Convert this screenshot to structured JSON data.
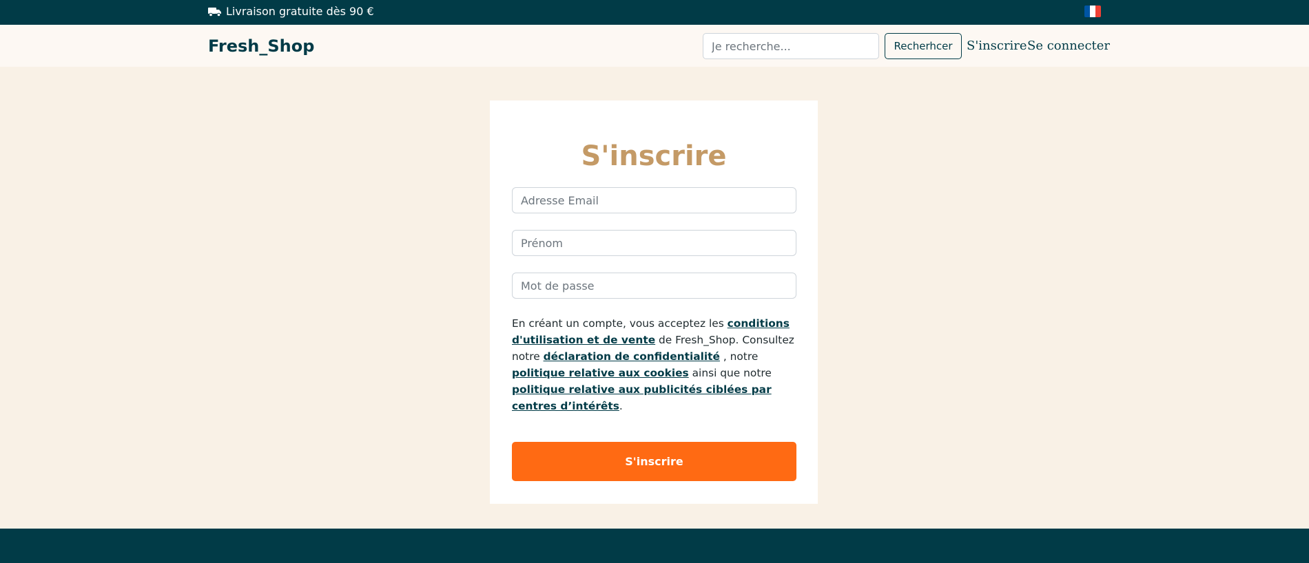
{
  "topbar": {
    "promo_text": "Livraison gratuite dès 90 €",
    "truck_icon": "truck-icon",
    "flag_icon": "france-flag-icon",
    "background_color": "#013b47"
  },
  "navbar": {
    "brand": "Fresh_Shop",
    "search": {
      "placeholder": "Je recherche...",
      "value": ""
    },
    "search_button_label": "Recherhcer",
    "signup_link": "S'inscrire",
    "login_link": "Se connecter"
  },
  "form": {
    "title": "S'inscrire",
    "email_placeholder": "Adresse Email",
    "firstname_placeholder": "Prénom",
    "password_placeholder": "Mot de passe",
    "legal": {
      "part1": "En créant un compte, vous acceptez les ",
      "link_terms": "conditions d'utilisation et de vente",
      "part2": " de Fresh_Shop. Consultez notre ",
      "link_privacy": "déclaration de confidentialité",
      "part3": " , notre ",
      "link_cookies": "politique relative aux cookies",
      "part4": " ainsi que notre ",
      "link_ads": "politique relative aux publicités ciblées par centres d’intérêts",
      "part5": "."
    },
    "submit_label": "S'inscrire"
  },
  "colors": {
    "primary": "#013b47",
    "accent": "#ff6a13",
    "title": "#c49a66",
    "page_background": "#f9f1e6"
  }
}
